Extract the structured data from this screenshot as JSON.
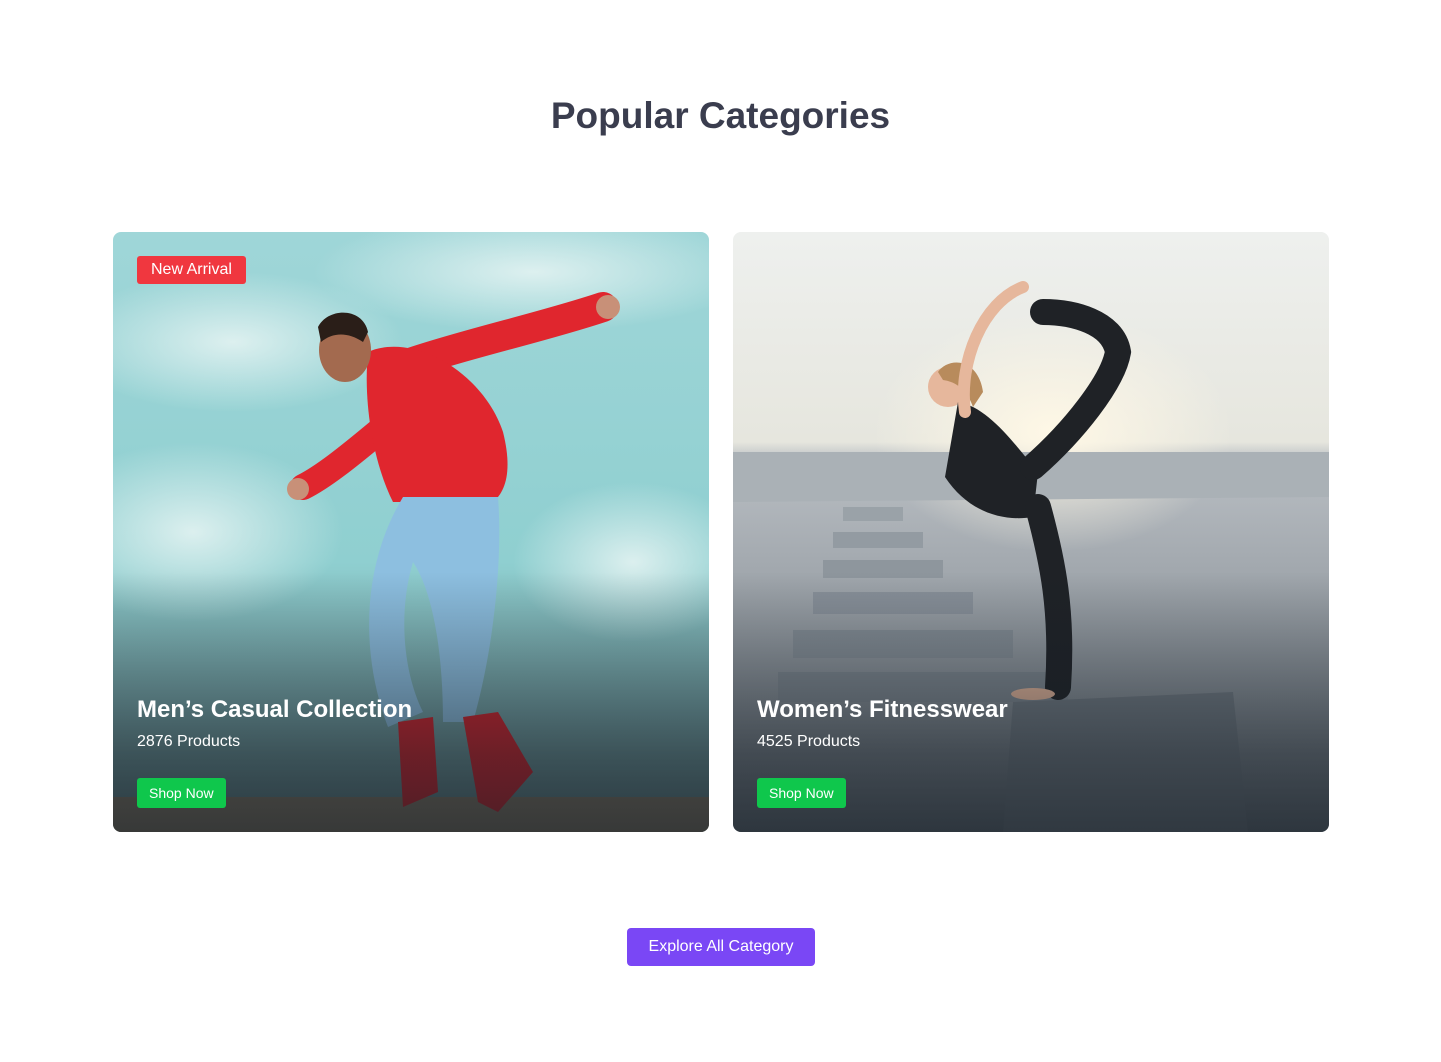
{
  "section": {
    "title": "Popular Categories"
  },
  "categories": [
    {
      "badge": "New Arrival",
      "title": "Men’s Casual Collection",
      "count": "2876 Products",
      "button_label": "Shop Now",
      "image": "man-jumping-red-hoodie-photo"
    },
    {
      "badge": "",
      "title": "Women’s Fitnesswear",
      "count": "4525 Products",
      "button_label": "Shop Now",
      "image": "woman-yoga-pose-photo"
    }
  ],
  "footer": {
    "explore_label": "Explore All Category"
  },
  "colors": {
    "title": "#3a3d4e",
    "badge": "#f0373f",
    "shop_button": "#0fc74c",
    "explore_button": "#7a47f5"
  }
}
